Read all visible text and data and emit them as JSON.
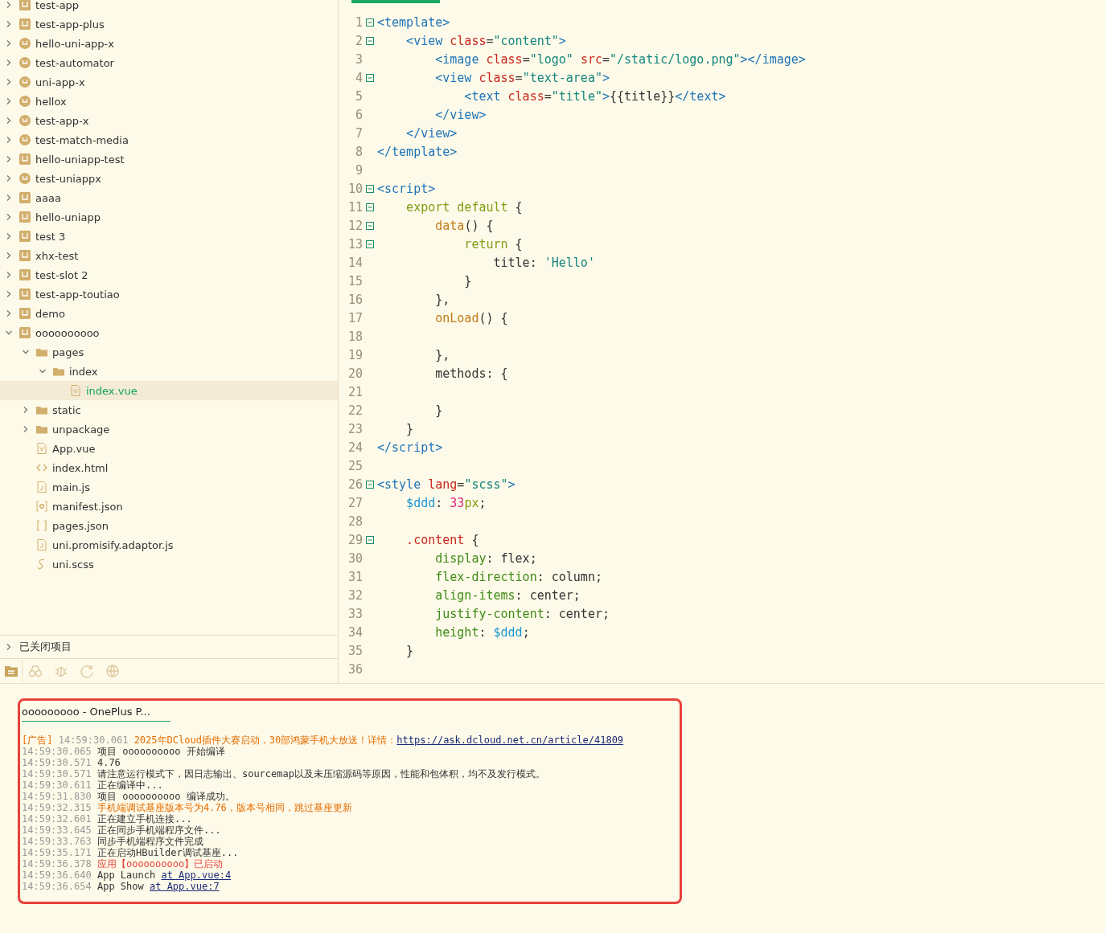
{
  "sidebar": {
    "tree": [
      {
        "label": "test-app",
        "kind": "square",
        "expanded": false,
        "selected": false
      },
      {
        "label": "test-app-plus",
        "kind": "square",
        "expanded": false,
        "selected": false
      },
      {
        "label": "hello-uni-app-x",
        "kind": "circle",
        "expanded": false,
        "selected": false
      },
      {
        "label": "test-automator",
        "kind": "circle",
        "expanded": false,
        "selected": false
      },
      {
        "label": "uni-app-x",
        "kind": "circle",
        "expanded": false,
        "selected": false
      },
      {
        "label": "hellox",
        "kind": "circle",
        "expanded": false,
        "selected": false
      },
      {
        "label": "test-app-x",
        "kind": "circle",
        "expanded": false,
        "selected": false
      },
      {
        "label": "test-match-media",
        "kind": "circle",
        "expanded": false,
        "selected": false
      },
      {
        "label": "hello-uniapp-test",
        "kind": "square",
        "expanded": false,
        "selected": false
      },
      {
        "label": "test-uniappx",
        "kind": "circle",
        "expanded": false,
        "selected": false
      },
      {
        "label": "aaaa",
        "kind": "square",
        "expanded": false,
        "selected": false
      },
      {
        "label": "hello-uniapp",
        "kind": "square",
        "expanded": false,
        "selected": false
      },
      {
        "label": "test 3",
        "kind": "square",
        "expanded": false,
        "selected": false
      },
      {
        "label": "xhx-test",
        "kind": "square",
        "expanded": false,
        "selected": false
      },
      {
        "label": "test-slot 2",
        "kind": "square",
        "expanded": false,
        "selected": false
      },
      {
        "label": "test-app-toutiao",
        "kind": "square",
        "expanded": false,
        "selected": false
      },
      {
        "label": "demo",
        "kind": "square",
        "expanded": false,
        "selected": false
      },
      {
        "label": "oooooooooo",
        "kind": "square",
        "expanded": true,
        "selected": false,
        "children": [
          {
            "label": "pages",
            "kind": "folder",
            "expanded": true,
            "selected": false,
            "children": [
              {
                "label": "index",
                "kind": "folder",
                "expanded": true,
                "selected": false,
                "children": [
                  {
                    "label": "index.vue",
                    "kind": "vue",
                    "selected": true
                  }
                ]
              }
            ]
          },
          {
            "label": "static",
            "kind": "folder",
            "expanded": false,
            "selected": false
          },
          {
            "label": "unpackage",
            "kind": "folder",
            "expanded": false,
            "selected": false
          },
          {
            "label": "App.vue",
            "kind": "vue",
            "selected": false
          },
          {
            "label": "index.html",
            "kind": "html",
            "selected": false
          },
          {
            "label": "main.js",
            "kind": "js",
            "selected": false
          },
          {
            "label": "manifest.json",
            "kind": "settings",
            "selected": false
          },
          {
            "label": "pages.json",
            "kind": "json",
            "selected": false
          },
          {
            "label": "uni.promisify.adaptor.js",
            "kind": "js",
            "selected": false
          },
          {
            "label": "uni.scss",
            "kind": "scss",
            "selected": false
          }
        ]
      }
    ],
    "closed_projects": {
      "label": "已关闭项目",
      "expanded": false
    },
    "toolbar": [
      {
        "kind": "files",
        "selected": true
      },
      {
        "kind": "binoculars",
        "selected": false
      },
      {
        "kind": "bug",
        "selected": false
      },
      {
        "kind": "refresh",
        "selected": false
      },
      {
        "kind": "globe",
        "selected": false
      }
    ]
  },
  "editor": {
    "lines": [
      {
        "num": "1",
        "fold": true,
        "tokens": [
          {
            "t": "<template>",
            "kind": "tag"
          }
        ]
      },
      {
        "num": "2",
        "fold": true,
        "tokens": [
          {
            "t": "    <view ",
            "kind": "tag"
          },
          {
            "t": "class",
            "kind": "attr"
          },
          {
            "t": "=",
            "kind": "plain"
          },
          {
            "t": "\"content\"",
            "kind": "str"
          },
          {
            "t": ">",
            "kind": "tag"
          }
        ]
      },
      {
        "num": "3",
        "fold": false,
        "tokens": [
          {
            "t": "        <image ",
            "kind": "tag"
          },
          {
            "t": "class",
            "kind": "attr"
          },
          {
            "t": "=",
            "kind": "plain"
          },
          {
            "t": "\"logo\" ",
            "kind": "str"
          },
          {
            "t": "src",
            "kind": "attr"
          },
          {
            "t": "=",
            "kind": "plain"
          },
          {
            "t": "\"/static/logo.png\"",
            "kind": "str"
          },
          {
            "t": "></image>",
            "kind": "tag"
          }
        ]
      },
      {
        "num": "4",
        "fold": true,
        "tokens": [
          {
            "t": "        <view ",
            "kind": "tag"
          },
          {
            "t": "class",
            "kind": "attr"
          },
          {
            "t": "=",
            "kind": "plain"
          },
          {
            "t": "\"text-area\"",
            "kind": "str"
          },
          {
            "t": ">",
            "kind": "tag"
          }
        ]
      },
      {
        "num": "5",
        "fold": false,
        "tokens": [
          {
            "t": "            <text ",
            "kind": "tag"
          },
          {
            "t": "class",
            "kind": "attr"
          },
          {
            "t": "=",
            "kind": "plain"
          },
          {
            "t": "\"title\"",
            "kind": "str"
          },
          {
            "t": ">",
            "kind": "tag"
          },
          {
            "t": "{{title}}",
            "kind": "plain"
          },
          {
            "t": "</text>",
            "kind": "tag"
          }
        ]
      },
      {
        "num": "6",
        "fold": false,
        "tokens": [
          {
            "t": "        </view>",
            "kind": "tag"
          }
        ]
      },
      {
        "num": "7",
        "fold": false,
        "tokens": [
          {
            "t": "    </view>",
            "kind": "tag"
          }
        ]
      },
      {
        "num": "8",
        "fold": false,
        "tokens": [
          {
            "t": "</template>",
            "kind": "tag"
          }
        ]
      },
      {
        "num": "9",
        "fold": false
      },
      {
        "num": "10",
        "fold": true,
        "tokens": [
          {
            "t": "<script>",
            "kind": "tag"
          }
        ]
      },
      {
        "num": "11",
        "fold": true,
        "tokens": [
          {
            "t": "    export default ",
            "kind": "kw"
          },
          {
            "t": "{",
            "kind": "plain"
          }
        ]
      },
      {
        "num": "12",
        "fold": true,
        "tokens": [
          {
            "t": "        data",
            "kind": "fn"
          },
          {
            "t": "() {",
            "kind": "plain"
          }
        ]
      },
      {
        "num": "13",
        "fold": true,
        "tokens": [
          {
            "t": "            return ",
            "kind": "kw"
          },
          {
            "t": "{",
            "kind": "plain"
          }
        ]
      },
      {
        "num": "14",
        "fold": false,
        "tokens": [
          {
            "t": "                title: ",
            "kind": "plain"
          },
          {
            "t": "'Hello'",
            "kind": "str"
          }
        ]
      },
      {
        "num": "15",
        "fold": false,
        "tokens": [
          {
            "t": "            }",
            "kind": "plain"
          }
        ]
      },
      {
        "num": "16",
        "fold": false,
        "tokens": [
          {
            "t": "        },",
            "kind": "plain"
          }
        ]
      },
      {
        "num": "17",
        "fold": false,
        "tokens": [
          {
            "t": "        onLoad",
            "kind": "fn"
          },
          {
            "t": "() {",
            "kind": "plain"
          }
        ]
      },
      {
        "num": "18",
        "fold": false
      },
      {
        "num": "19",
        "fold": false,
        "tokens": [
          {
            "t": "        },",
            "kind": "plain"
          }
        ]
      },
      {
        "num": "20",
        "fold": false,
        "tokens": [
          {
            "t": "        methods: {",
            "kind": "plain"
          }
        ]
      },
      {
        "num": "21",
        "fold": false
      },
      {
        "num": "22",
        "fold": false,
        "tokens": [
          {
            "t": "        }",
            "kind": "plain"
          }
        ]
      },
      {
        "num": "23",
        "fold": false,
        "tokens": [
          {
            "t": "    }",
            "kind": "plain"
          }
        ]
      },
      {
        "num": "24",
        "fold": false,
        "tokens": [
          {
            "t": "</script>",
            "kind": "tag"
          }
        ]
      },
      {
        "num": "25",
        "fold": false
      },
      {
        "num": "26",
        "fold": true,
        "tokens": [
          {
            "t": "<style ",
            "kind": "tag"
          },
          {
            "t": "lang",
            "kind": "attr"
          },
          {
            "t": "=",
            "kind": "plain"
          },
          {
            "t": "\"scss\"",
            "kind": "str"
          },
          {
            "t": ">",
            "kind": "tag"
          }
        ]
      },
      {
        "num": "27",
        "fold": false,
        "tokens": [
          {
            "t": "    $ddd",
            "kind": "var"
          },
          {
            "t": ": ",
            "kind": "plain"
          },
          {
            "t": "33",
            "kind": "num"
          },
          {
            "t": "px",
            "kind": "kw"
          },
          {
            "t": ";",
            "kind": "plain"
          }
        ]
      },
      {
        "num": "28",
        "fold": false
      },
      {
        "num": "29",
        "fold": true,
        "tokens": [
          {
            "t": "    .content ",
            "kind": "attr"
          },
          {
            "t": "{",
            "kind": "plain"
          }
        ]
      },
      {
        "num": "30",
        "fold": false,
        "tokens": [
          {
            "t": "        display",
            "kind": "prop"
          },
          {
            "t": ": flex;",
            "kind": "plain"
          }
        ]
      },
      {
        "num": "31",
        "fold": false,
        "tokens": [
          {
            "t": "        flex-direction",
            "kind": "prop"
          },
          {
            "t": ": column;",
            "kind": "plain"
          }
        ]
      },
      {
        "num": "32",
        "fold": false,
        "tokens": [
          {
            "t": "        align-items",
            "kind": "prop"
          },
          {
            "t": ": center;",
            "kind": "plain"
          }
        ]
      },
      {
        "num": "33",
        "fold": false,
        "tokens": [
          {
            "t": "        justify-content",
            "kind": "prop"
          },
          {
            "t": ": center;",
            "kind": "plain"
          }
        ]
      },
      {
        "num": "34",
        "fold": false,
        "tokens": [
          {
            "t": "        height",
            "kind": "prop"
          },
          {
            "t": ": ",
            "kind": "plain"
          },
          {
            "t": "$ddd",
            "kind": "var"
          },
          {
            "t": ";",
            "kind": "plain"
          }
        ]
      },
      {
        "num": "35",
        "fold": false,
        "tokens": [
          {
            "t": "    }",
            "kind": "plain"
          }
        ]
      },
      {
        "num": "36",
        "fold": false
      }
    ]
  },
  "console": {
    "highlighted": true,
    "tab": {
      "label": "ooooooooo - OnePlus P...",
      "selected": true
    },
    "lines": [
      {
        "prefix": "[广告]",
        "time": "14:59:30.061",
        "kind": "warn",
        "text": "2025年DCloud插件大赛启动，30部鸿蒙手机大放送！详情：",
        "link": "https://ask.dcloud.net.cn/article/41809"
      },
      {
        "time": "14:59:30.065",
        "kind": "normal",
        "text": "项目 oooooooooo 开始编译"
      },
      {
        "time": "14:59:30.571",
        "kind": "normal",
        "text": "4.76"
      },
      {
        "time": "14:59:30.571",
        "kind": "normal",
        "text": "请注意运行模式下，因日志输出、sourcemap以及未压缩源码等原因，性能和包体积，均不及发行模式。"
      },
      {
        "time": "14:59:30.611",
        "kind": "normal",
        "text": "正在编译中..."
      },
      {
        "time": "14:59:31.830",
        "kind": "normal",
        "text": "项目 oooooooooo 编译成功。"
      },
      {
        "time": "14:59:32.315",
        "kind": "warn",
        "text": "手机端调试基座版本号为4.76，版本号相同，跳过基座更新"
      },
      {
        "time": "14:59:32.601",
        "kind": "normal",
        "text": "正在建立手机连接..."
      },
      {
        "time": "14:59:33.645",
        "kind": "normal",
        "text": "正在同步手机端程序文件..."
      },
      {
        "time": "14:59:33.763",
        "kind": "normal",
        "text": "同步手机端程序文件完成"
      },
      {
        "time": "14:59:35.171",
        "kind": "normal",
        "text": "正在启动HBuilder调试基座..."
      },
      {
        "time": "14:59:36.378",
        "kind": "error",
        "text": "应用【oooooooooo】已启动"
      },
      {
        "time": "14:59:36.640",
        "kind": "normal",
        "text": "App Launch ",
        "link": "at App.vue:4"
      },
      {
        "time": "14:59:36.654",
        "kind": "normal",
        "text": "App Show ",
        "link": "at App.vue:7"
      }
    ]
  }
}
